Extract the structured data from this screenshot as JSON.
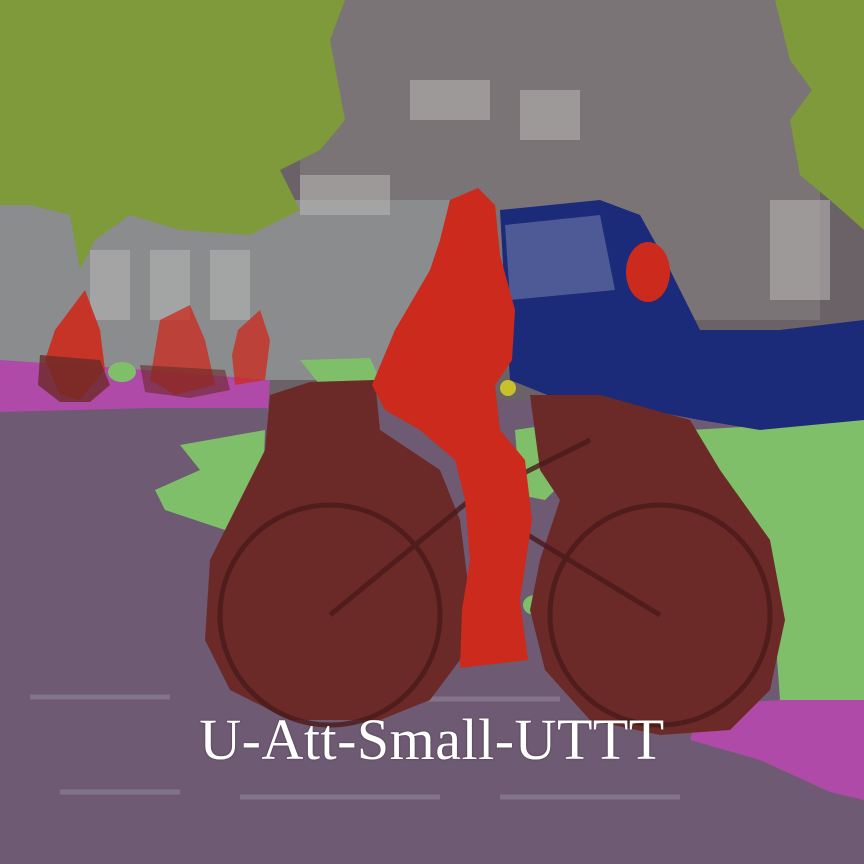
{
  "caption": "U-Att-Small-UTTT",
  "palette": {
    "vegetation": "#7f9a3a",
    "building": "#5c5458",
    "road": "#6e5a72",
    "sidewalk": "#b04aa8",
    "terrain": "#7fbf6a",
    "person": "#cc2a1c",
    "bicycle": "#6b2a28",
    "car": "#1c2a7a"
  }
}
